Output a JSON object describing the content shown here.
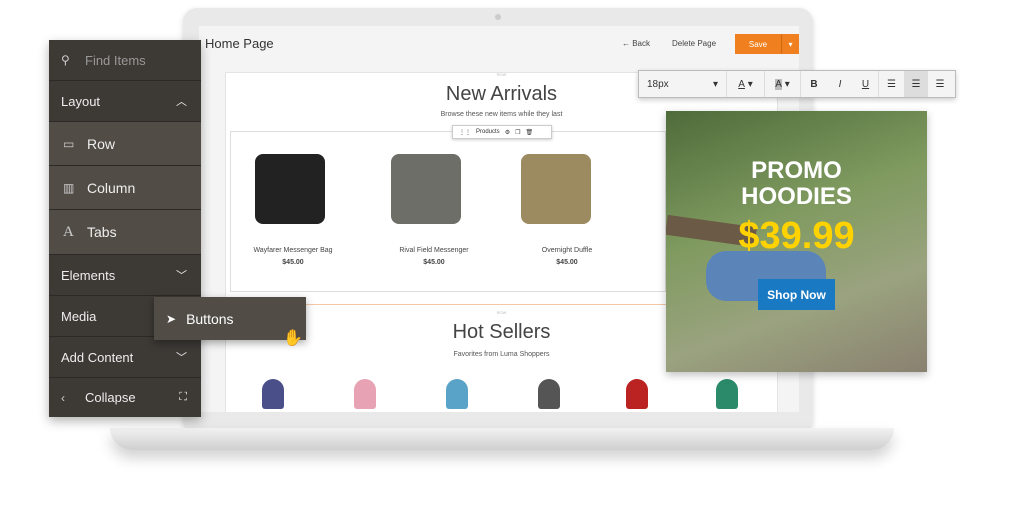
{
  "editor": {
    "page_title": "Home Page",
    "back": "← Back",
    "delete": "Delete Page",
    "save": "Save",
    "row_label": "ROW",
    "new_arrivals": {
      "title": "New Arrivals",
      "subtitle": "Browse these new items while they last",
      "toolbar_label": "Products",
      "products": [
        {
          "name": "Wayfarer Messenger Bag",
          "price": "$45.00"
        },
        {
          "name": "Rival Field Messenger",
          "price": "$45.00"
        },
        {
          "name": "Overnight Duffle",
          "price": "$45.00"
        }
      ]
    },
    "hot_sellers": {
      "title": "Hot Sellers",
      "subtitle": "Favorites from Luma Shoppers"
    }
  },
  "sidebar": {
    "search_placeholder": "Find Items",
    "layout": "Layout",
    "row": "Row",
    "column": "Column",
    "tabs": "Tabs",
    "elements": "Elements",
    "media": "Media",
    "add_content": "Add Content",
    "collapse": "Collapse"
  },
  "drag_item": "Buttons",
  "text_toolbar": {
    "font_size": "18px",
    "color": "A",
    "highlight": "A",
    "bold": "B",
    "italic": "I",
    "underline": "U"
  },
  "promo": {
    "line1": "PROMO",
    "line2": "HOODIES",
    "price": "$39.99",
    "cta": "Shop Now",
    "price_color": "#ffd200",
    "cta_color": "#1979c3"
  },
  "colors": {
    "save": "#f0801f",
    "sidebar": "#3d3935"
  }
}
